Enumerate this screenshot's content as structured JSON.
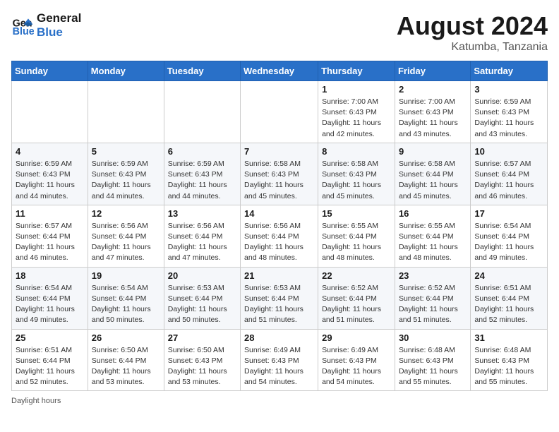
{
  "header": {
    "logo_line1": "General",
    "logo_line2": "Blue",
    "month_year": "August 2024",
    "location": "Katumba, Tanzania"
  },
  "days_of_week": [
    "Sunday",
    "Monday",
    "Tuesday",
    "Wednesday",
    "Thursday",
    "Friday",
    "Saturday"
  ],
  "weeks": [
    [
      {
        "day": "",
        "info": ""
      },
      {
        "day": "",
        "info": ""
      },
      {
        "day": "",
        "info": ""
      },
      {
        "day": "",
        "info": ""
      },
      {
        "day": "1",
        "info": "Sunrise: 7:00 AM\nSunset: 6:43 PM\nDaylight: 11 hours\nand 42 minutes."
      },
      {
        "day": "2",
        "info": "Sunrise: 7:00 AM\nSunset: 6:43 PM\nDaylight: 11 hours\nand 43 minutes."
      },
      {
        "day": "3",
        "info": "Sunrise: 6:59 AM\nSunset: 6:43 PM\nDaylight: 11 hours\nand 43 minutes."
      }
    ],
    [
      {
        "day": "4",
        "info": "Sunrise: 6:59 AM\nSunset: 6:43 PM\nDaylight: 11 hours\nand 44 minutes."
      },
      {
        "day": "5",
        "info": "Sunrise: 6:59 AM\nSunset: 6:43 PM\nDaylight: 11 hours\nand 44 minutes."
      },
      {
        "day": "6",
        "info": "Sunrise: 6:59 AM\nSunset: 6:43 PM\nDaylight: 11 hours\nand 44 minutes."
      },
      {
        "day": "7",
        "info": "Sunrise: 6:58 AM\nSunset: 6:43 PM\nDaylight: 11 hours\nand 45 minutes."
      },
      {
        "day": "8",
        "info": "Sunrise: 6:58 AM\nSunset: 6:43 PM\nDaylight: 11 hours\nand 45 minutes."
      },
      {
        "day": "9",
        "info": "Sunrise: 6:58 AM\nSunset: 6:44 PM\nDaylight: 11 hours\nand 45 minutes."
      },
      {
        "day": "10",
        "info": "Sunrise: 6:57 AM\nSunset: 6:44 PM\nDaylight: 11 hours\nand 46 minutes."
      }
    ],
    [
      {
        "day": "11",
        "info": "Sunrise: 6:57 AM\nSunset: 6:44 PM\nDaylight: 11 hours\nand 46 minutes."
      },
      {
        "day": "12",
        "info": "Sunrise: 6:56 AM\nSunset: 6:44 PM\nDaylight: 11 hours\nand 47 minutes."
      },
      {
        "day": "13",
        "info": "Sunrise: 6:56 AM\nSunset: 6:44 PM\nDaylight: 11 hours\nand 47 minutes."
      },
      {
        "day": "14",
        "info": "Sunrise: 6:56 AM\nSunset: 6:44 PM\nDaylight: 11 hours\nand 48 minutes."
      },
      {
        "day": "15",
        "info": "Sunrise: 6:55 AM\nSunset: 6:44 PM\nDaylight: 11 hours\nand 48 minutes."
      },
      {
        "day": "16",
        "info": "Sunrise: 6:55 AM\nSunset: 6:44 PM\nDaylight: 11 hours\nand 48 minutes."
      },
      {
        "day": "17",
        "info": "Sunrise: 6:54 AM\nSunset: 6:44 PM\nDaylight: 11 hours\nand 49 minutes."
      }
    ],
    [
      {
        "day": "18",
        "info": "Sunrise: 6:54 AM\nSunset: 6:44 PM\nDaylight: 11 hours\nand 49 minutes."
      },
      {
        "day": "19",
        "info": "Sunrise: 6:54 AM\nSunset: 6:44 PM\nDaylight: 11 hours\nand 50 minutes."
      },
      {
        "day": "20",
        "info": "Sunrise: 6:53 AM\nSunset: 6:44 PM\nDaylight: 11 hours\nand 50 minutes."
      },
      {
        "day": "21",
        "info": "Sunrise: 6:53 AM\nSunset: 6:44 PM\nDaylight: 11 hours\nand 51 minutes."
      },
      {
        "day": "22",
        "info": "Sunrise: 6:52 AM\nSunset: 6:44 PM\nDaylight: 11 hours\nand 51 minutes."
      },
      {
        "day": "23",
        "info": "Sunrise: 6:52 AM\nSunset: 6:44 PM\nDaylight: 11 hours\nand 51 minutes."
      },
      {
        "day": "24",
        "info": "Sunrise: 6:51 AM\nSunset: 6:44 PM\nDaylight: 11 hours\nand 52 minutes."
      }
    ],
    [
      {
        "day": "25",
        "info": "Sunrise: 6:51 AM\nSunset: 6:44 PM\nDaylight: 11 hours\nand 52 minutes."
      },
      {
        "day": "26",
        "info": "Sunrise: 6:50 AM\nSunset: 6:44 PM\nDaylight: 11 hours\nand 53 minutes."
      },
      {
        "day": "27",
        "info": "Sunrise: 6:50 AM\nSunset: 6:43 PM\nDaylight: 11 hours\nand 53 minutes."
      },
      {
        "day": "28",
        "info": "Sunrise: 6:49 AM\nSunset: 6:43 PM\nDaylight: 11 hours\nand 54 minutes."
      },
      {
        "day": "29",
        "info": "Sunrise: 6:49 AM\nSunset: 6:43 PM\nDaylight: 11 hours\nand 54 minutes."
      },
      {
        "day": "30",
        "info": "Sunrise: 6:48 AM\nSunset: 6:43 PM\nDaylight: 11 hours\nand 55 minutes."
      },
      {
        "day": "31",
        "info": "Sunrise: 6:48 AM\nSunset: 6:43 PM\nDaylight: 11 hours\nand 55 minutes."
      }
    ]
  ],
  "footer": {
    "daylight_label": "Daylight hours"
  }
}
